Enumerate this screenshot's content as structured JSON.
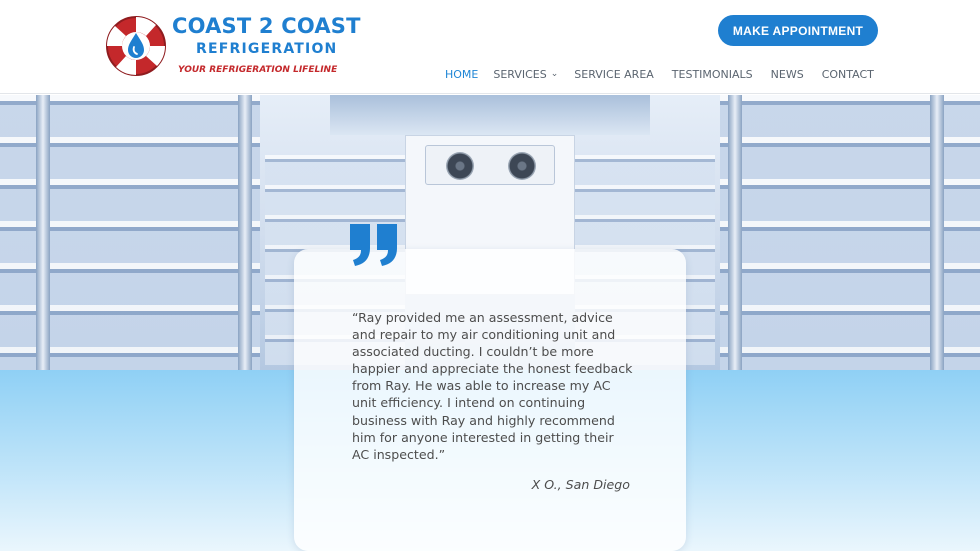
{
  "brand": {
    "name_line1": "COAST 2 COAST",
    "name_line2": "REFRIGERATION",
    "tagline": "YOUR REFRIGERATION LIFELINE"
  },
  "header": {
    "cta_label": "MAKE APPOINTMENT"
  },
  "nav": [
    {
      "label": "HOME",
      "active": true
    },
    {
      "label": "SERVICES",
      "has_dropdown": true
    },
    {
      "label": "SERVICE AREA"
    },
    {
      "label": "TESTIMONIALS"
    },
    {
      "label": "NEWS"
    },
    {
      "label": "CONTACT"
    }
  ],
  "testimonial": {
    "quote": "“Ray provided me an assessment, advice and repair to my air conditioning unit and associated ducting. I couldn’t be more happier and appreciate the honest feedback from Ray. He was able to increase my AC unit efficiency. I intend on continuing business with Ray and highly recommend him for anyone interested in getting their AC inspected.”",
    "author": "X O., San Diego"
  },
  "colors": {
    "brand_blue": "#1f7fd0",
    "brand_red": "#c4282b",
    "nav_active": "#1f86d6",
    "band_blue": "#8fd0f5"
  },
  "icons": {
    "logo": "lifebuoy-drop-icon",
    "quote": "quote-icon",
    "dropdown": "chevron-down-icon"
  }
}
